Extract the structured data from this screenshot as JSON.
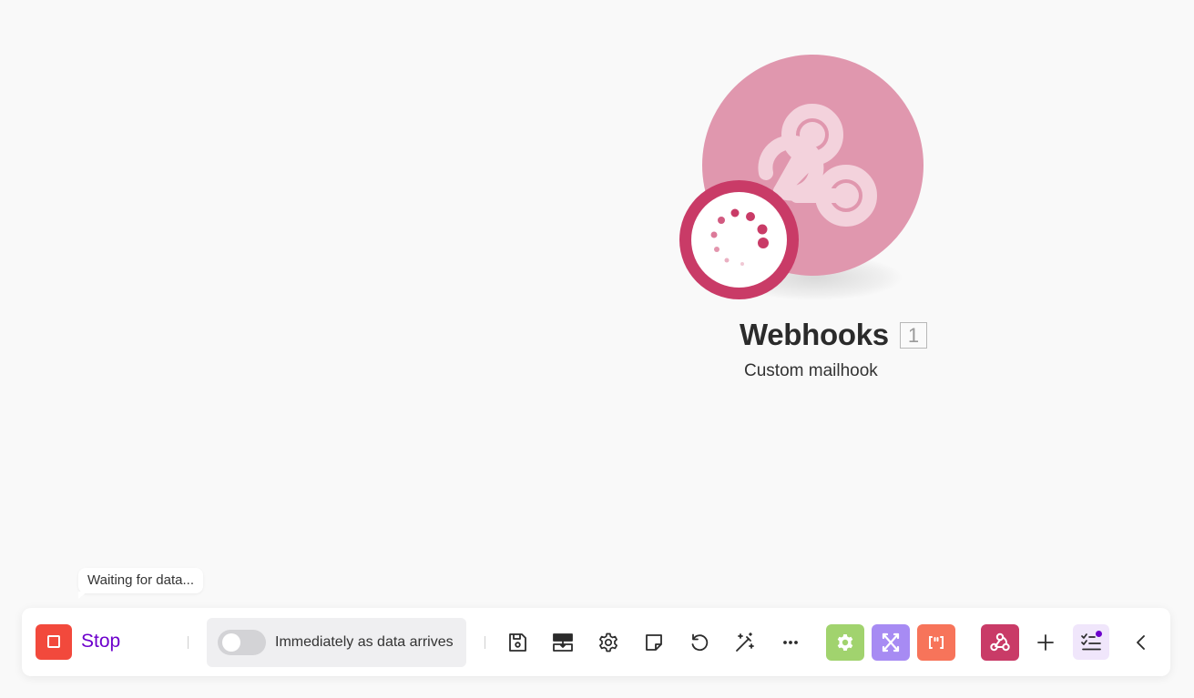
{
  "module": {
    "name": "Webhooks",
    "badge": "1",
    "subtitle": "Custom mailhook",
    "color": "#e097ae",
    "status_color": "#c93b67",
    "icon": "webhook-icon",
    "status_icon": "loading-spinner-icon"
  },
  "tooltip": {
    "text": "Waiting for data..."
  },
  "toolbar": {
    "stop_label": "Stop",
    "stop_icon": "stop-square-icon",
    "schedule": {
      "label": "Immediately as data arrives",
      "enabled": false
    },
    "actions": [
      {
        "name": "save",
        "icon": "save-icon"
      },
      {
        "name": "auto-align",
        "icon": "align-icon"
      },
      {
        "name": "scenario-settings",
        "icon": "gear-icon"
      },
      {
        "name": "notes",
        "icon": "note-icon"
      },
      {
        "name": "history",
        "icon": "undo-icon"
      },
      {
        "name": "ai-magic",
        "icon": "magic-wand-icon"
      },
      {
        "name": "more",
        "icon": "more-dots-icon"
      }
    ],
    "tools": [
      {
        "name": "tools",
        "icon": "gear-icon",
        "color": "#a1d36e"
      },
      {
        "name": "flow-control",
        "icon": "flow-control-icon",
        "color": "#a78bf3"
      },
      {
        "name": "text-parser",
        "icon": "brackets-icon",
        "color": "#f7745a"
      },
      {
        "name": "webhooks",
        "icon": "webhook-icon",
        "color": "#c93b67"
      }
    ],
    "accent_color": "#6d00cc",
    "stop_color": "#f2493c"
  }
}
